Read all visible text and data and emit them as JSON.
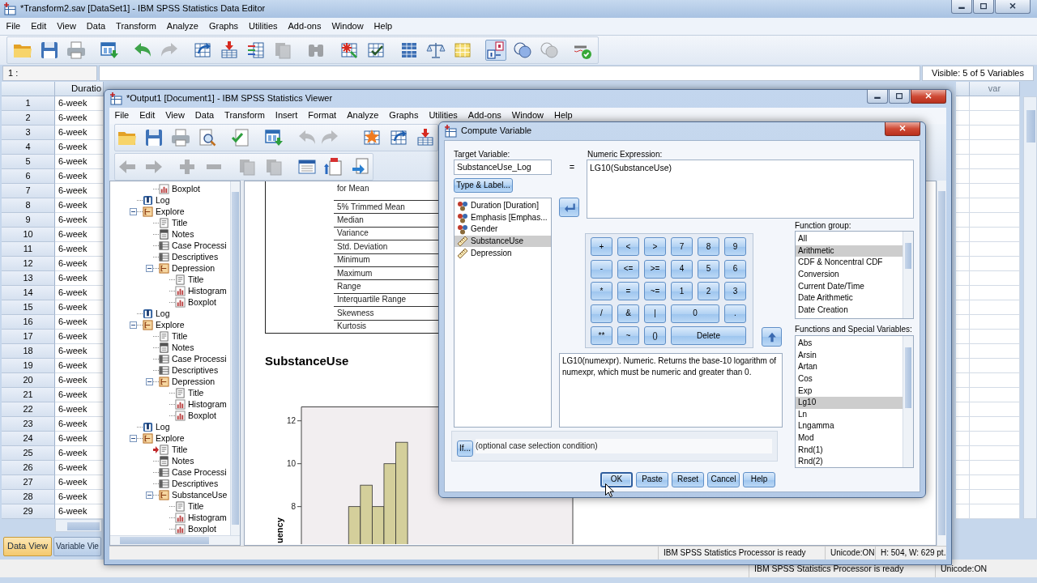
{
  "data_editor": {
    "title": "*Transform2.sav [DataSet1] - IBM SPSS Statistics Data Editor",
    "active": false,
    "menu": [
      "File",
      "Edit",
      "View",
      "Data",
      "Transform",
      "Analyze",
      "Graphs",
      "Utilities",
      "Add-ons",
      "Window",
      "Help"
    ],
    "toolbar": [
      {
        "disabled": false,
        "pressed": false
      },
      {
        "disabled": false,
        "pressed": false
      },
      {
        "disabled": false,
        "pressed": false
      },
      {
        "disabled": false,
        "pressed": false
      },
      {
        "disabled": false,
        "pressed": false
      },
      {
        "disabled": true,
        "pressed": false
      },
      {
        "disabled": false,
        "pressed": false
      },
      {
        "disabled": false,
        "pressed": false
      },
      {
        "disabled": false,
        "pressed": false
      },
      {
        "disabled": true,
        "pressed": false
      },
      {
        "disabled": true,
        "pressed": false
      },
      {
        "disabled": false,
        "pressed": false
      },
      {
        "disabled": false,
        "pressed": false
      },
      {
        "disabled": false,
        "pressed": false
      },
      {
        "disabled": false,
        "pressed": false
      },
      {
        "disabled": false,
        "pressed": false
      },
      {
        "disabled": false,
        "pressed": true
      },
      {
        "disabled": false,
        "pressed": false
      },
      {
        "disabled": true,
        "pressed": false
      },
      {
        "disabled": false,
        "pressed": false
      }
    ],
    "cell_reference": "1 :",
    "visible_variables": "Visible: 5 of 5 Variables",
    "columns": [
      "Duratio",
      "var"
    ],
    "rows": [
      {
        "number": "1",
        "cells": [
          "6-week"
        ]
      },
      {
        "number": "2",
        "cells": [
          "6-week"
        ]
      },
      {
        "number": "3",
        "cells": [
          "6-week"
        ]
      },
      {
        "number": "4",
        "cells": [
          "6-week"
        ]
      },
      {
        "number": "5",
        "cells": [
          "6-week"
        ]
      },
      {
        "number": "6",
        "cells": [
          "6-week"
        ]
      },
      {
        "number": "7",
        "cells": [
          "6-week"
        ]
      },
      {
        "number": "8",
        "cells": [
          "6-week"
        ]
      },
      {
        "number": "9",
        "cells": [
          "6-week"
        ]
      },
      {
        "number": "10",
        "cells": [
          "6-week"
        ]
      },
      {
        "number": "11",
        "cells": [
          "6-week"
        ]
      },
      {
        "number": "12",
        "cells": [
          "6-week"
        ]
      },
      {
        "number": "13",
        "cells": [
          "6-week"
        ]
      },
      {
        "number": "14",
        "cells": [
          "6-week"
        ]
      },
      {
        "number": "15",
        "cells": [
          "6-week"
        ]
      },
      {
        "number": "16",
        "cells": [
          "6-week"
        ]
      },
      {
        "number": "17",
        "cells": [
          "6-week"
        ]
      },
      {
        "number": "18",
        "cells": [
          "6-week"
        ]
      },
      {
        "number": "19",
        "cells": [
          "6-week"
        ]
      },
      {
        "number": "20",
        "cells": [
          "6-week"
        ]
      },
      {
        "number": "21",
        "cells": [
          "6-week"
        ]
      },
      {
        "number": "22",
        "cells": [
          "6-week"
        ]
      },
      {
        "number": "23",
        "cells": [
          "6-week"
        ]
      },
      {
        "number": "24",
        "cells": [
          "6-week"
        ]
      },
      {
        "number": "25",
        "cells": [
          "6-week"
        ]
      },
      {
        "number": "26",
        "cells": [
          "6-week"
        ]
      },
      {
        "number": "27",
        "cells": [
          "6-week"
        ]
      },
      {
        "number": "28",
        "cells": [
          "6-week"
        ]
      },
      {
        "number": "29",
        "cells": [
          "6-week"
        ]
      }
    ],
    "tabs": [
      {
        "label": "Data View",
        "selected": true
      },
      {
        "label": "Variable Vie",
        "selected": false
      }
    ],
    "status_bar": [
      "IBM SPSS Statistics Processor is ready",
      "Unicode:ON"
    ]
  },
  "viewer": {
    "title": "*Output1 [Document1] - IBM SPSS Statistics Viewer",
    "active": true,
    "menu": [
      "File",
      "Edit",
      "View",
      "Data",
      "Transform",
      "Insert",
      "Format",
      "Analyze",
      "Graphs",
      "Utilities",
      "Add-ons",
      "Window",
      "Help"
    ],
    "toolbar_rows": [
      [
        {
          "disabled": false
        },
        {
          "disabled": false
        },
        {
          "disabled": false
        },
        {
          "disabled": false
        },
        {
          "disabled": false
        },
        {
          "disabled": false
        },
        {
          "disabled": true
        },
        {
          "disabled": true
        },
        {
          "disabled": false
        },
        {
          "disabled": false
        },
        {
          "disabled": false
        }
      ],
      [
        {
          "disabled": true
        },
        {
          "disabled": true
        },
        {
          "disabled": true
        },
        {
          "disabled": true
        },
        {
          "disabled": true
        },
        {
          "disabled": true
        },
        {
          "disabled": false
        },
        {
          "disabled": false
        },
        {
          "disabled": false
        }
      ]
    ],
    "outline": [
      {
        "children": [
          {
            "label": "Boxplot",
            "kind": "chart",
            "current": false
          }
        ]
      },
      {
        "label": "Log",
        "kind": "log",
        "current": false
      },
      {
        "label": "Explore",
        "kind": "procedure",
        "expanded": true,
        "current": false,
        "children": [
          {
            "label": "Title",
            "kind": "title",
            "current": false
          },
          {
            "label": "Notes",
            "kind": "notes",
            "current": false
          },
          {
            "label": "Case Processi",
            "kind": "table",
            "current": false
          },
          {
            "label": "Descriptives",
            "kind": "table",
            "current": false
          },
          {
            "label": "Depression",
            "kind": "procedure",
            "expanded": true,
            "current": false,
            "children": [
              {
                "label": "Title",
                "kind": "title",
                "current": false
              },
              {
                "label": "Histogram",
                "kind": "chart",
                "current": false
              },
              {
                "label": "Boxplot",
                "kind": "chart",
                "current": false
              }
            ]
          }
        ]
      },
      {
        "label": "Log",
        "kind": "log",
        "current": false
      },
      {
        "label": "Explore",
        "kind": "procedure",
        "expanded": true,
        "current": false,
        "children": [
          {
            "label": "Title",
            "kind": "title",
            "current": false
          },
          {
            "label": "Notes",
            "kind": "notes",
            "current": false
          },
          {
            "label": "Case Processi",
            "kind": "table",
            "current": false
          },
          {
            "label": "Descriptives",
            "kind": "table",
            "current": false
          },
          {
            "label": "Depression",
            "kind": "procedure",
            "expanded": true,
            "current": false,
            "children": [
              {
                "label": "Title",
                "kind": "title",
                "current": false
              },
              {
                "label": "Histogram",
                "kind": "chart",
                "current": false
              },
              {
                "label": "Boxplot",
                "kind": "chart",
                "current": false
              }
            ]
          }
        ]
      },
      {
        "label": "Log",
        "kind": "log",
        "current": false
      },
      {
        "label": "Explore",
        "kind": "procedure",
        "expanded": true,
        "current": false,
        "children": [
          {
            "label": "Title",
            "kind": "title",
            "current": true
          },
          {
            "label": "Notes",
            "kind": "notes",
            "current": false
          },
          {
            "label": "Case Processi",
            "kind": "table",
            "current": false
          },
          {
            "label": "Descriptives",
            "kind": "table",
            "current": false
          },
          {
            "label": "SubstanceUse",
            "kind": "procedure",
            "expanded": true,
            "current": false,
            "children": [
              {
                "label": "Title",
                "kind": "title",
                "current": false
              },
              {
                "label": "Histogram",
                "kind": "chart",
                "current": false
              },
              {
                "label": "Boxplot",
                "kind": "chart",
                "current": false
              }
            ]
          }
        ]
      }
    ],
    "table_rows": [
      "for Mean",
      "5% Trimmed Mean",
      "Median",
      "Variance",
      "Std. Deviation",
      "Minimum",
      "Maximum",
      "Range",
      "Interquartile Range",
      "Skewness",
      "Kurtosis"
    ],
    "heading": "SubstanceUse",
    "chart_data": {
      "type": "bar",
      "ylabel": "uency",
      "categories": [
        null,
        null,
        null,
        null,
        null,
        null,
        null,
        null,
        null,
        null,
        null,
        null,
        null,
        null,
        null,
        null,
        null,
        null,
        null,
        null,
        null,
        null,
        null
      ],
      "values": [
        null,
        null,
        null,
        null,
        8,
        9,
        8,
        10,
        11,
        null,
        null,
        null,
        null,
        null,
        null,
        null,
        null,
        null,
        null,
        null,
        null,
        null,
        null
      ],
      "yticks": [
        8,
        10,
        12
      ],
      "ylim": [
        6.25,
        12.65
      ]
    },
    "status_bar": [
      "IBM SPSS Statistics Processor is ready",
      "Unicode:ON",
      "H: 504, W: 629 pt."
    ]
  },
  "dialog": {
    "title": "Compute Variable",
    "active": true,
    "target_label": "Target Variable:",
    "target_value": "SubstanceUse_Log",
    "equals_sign": "=",
    "expression_label": "Numeric Expression:",
    "expression": "LG10(SubstanceUse)",
    "type_label_button": "Type & Label...",
    "variables": [
      {
        "label": "Duration [Duration]",
        "kind": "nominal",
        "selected": false
      },
      {
        "label": "Emphasis [Emphas...",
        "kind": "nominal",
        "selected": false
      },
      {
        "label": "Gender",
        "kind": "nominal",
        "selected": false
      },
      {
        "label": "SubstanceUse",
        "kind": "scale",
        "selected": true
      },
      {
        "label": "Depression",
        "kind": "scale",
        "selected": false
      }
    ],
    "keypad": [
      [
        "+",
        "<",
        ">",
        "7",
        "8",
        "9"
      ],
      [
        "-",
        "<=",
        ">=",
        "4",
        "5",
        "6"
      ],
      [
        "*",
        "=",
        "~=",
        "1",
        "2",
        "3"
      ],
      [
        "/",
        "&",
        "|",
        "0",
        "."
      ],
      [
        "**",
        "~",
        "()",
        "Delete"
      ]
    ],
    "description": "LG10(numexpr). Numeric. Returns the base-10 logarithm of numexpr, which must be numeric and greater than 0.",
    "function_group_label": "Function group:",
    "function_groups": [
      {
        "label": "All",
        "selected": false
      },
      {
        "label": "Arithmetic",
        "selected": true
      },
      {
        "label": "CDF & Noncentral CDF",
        "selected": false
      },
      {
        "label": "Conversion",
        "selected": false
      },
      {
        "label": "Current Date/Time",
        "selected": false
      },
      {
        "label": "Date Arithmetic",
        "selected": false
      },
      {
        "label": "Date Creation",
        "selected": false
      }
    ],
    "functions_label": "Functions and Special Variables:",
    "functions": [
      {
        "label": "Abs",
        "selected": false
      },
      {
        "label": "Arsin",
        "selected": false
      },
      {
        "label": "Artan",
        "selected": false
      },
      {
        "label": "Cos",
        "selected": false
      },
      {
        "label": "Exp",
        "selected": false
      },
      {
        "label": "Lg10",
        "selected": true
      },
      {
        "label": "Ln",
        "selected": false
      },
      {
        "label": "Lngamma",
        "selected": false
      },
      {
        "label": "Mod",
        "selected": false
      },
      {
        "label": "Rnd(1)",
        "selected": false
      },
      {
        "label": "Rnd(2)",
        "selected": false
      }
    ],
    "if_button": "If...",
    "if_condition": "(optional case selection condition)",
    "buttons": [
      {
        "label": "OK",
        "focused": true
      },
      {
        "label": "Paste",
        "focused": false
      },
      {
        "label": "Reset",
        "focused": false
      },
      {
        "label": "Cancel",
        "focused": false
      },
      {
        "label": "Help",
        "focused": false
      }
    ]
  }
}
